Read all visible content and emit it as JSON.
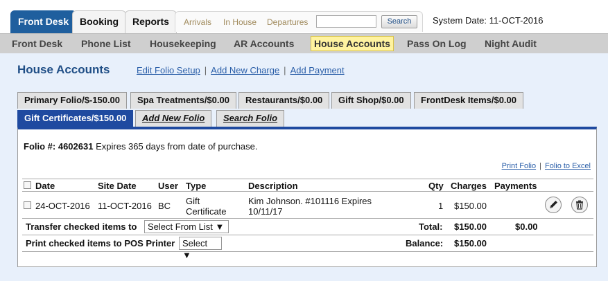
{
  "top_nav": {
    "tabs": [
      {
        "label": "Front Desk",
        "active": true
      },
      {
        "label": "Booking",
        "active": false
      },
      {
        "label": "Reports",
        "active": false
      }
    ],
    "quick_links": [
      "Arrivals",
      "In House",
      "Departures"
    ],
    "search": {
      "value": "",
      "button_label": "Search"
    },
    "system_date": "System Date: 11-OCT-2016"
  },
  "sub_nav": {
    "items": [
      {
        "label": "Front Desk",
        "active": false
      },
      {
        "label": "Phone List",
        "active": false
      },
      {
        "label": "Housekeeping",
        "active": false
      },
      {
        "label": "AR Accounts",
        "active": false
      },
      {
        "label": "House Accounts",
        "active": true
      },
      {
        "label": "Pass On Log",
        "active": false
      },
      {
        "label": "Night Audit",
        "active": false
      }
    ]
  },
  "page": {
    "title": "House Accounts",
    "actions": [
      "Edit Folio Setup",
      "Add New Charge",
      "Add Payment"
    ]
  },
  "folio_tabs": {
    "row1": [
      "Primary Folio/$-150.00",
      "Spa Treatments/$0.00",
      "Restaurants/$0.00",
      "Gift Shop/$0.00",
      "FrontDesk Items/$0.00"
    ],
    "row2": [
      {
        "label": "Gift Certificates/$150.00",
        "active": true
      },
      {
        "label": "Add New Folio",
        "active": false
      },
      {
        "label": "Search Folio",
        "active": false
      }
    ]
  },
  "folio": {
    "number_label": "Folio #:",
    "number": "4602631",
    "note": "Expires 365 days from date of purchase.",
    "print_links": [
      "Print Folio",
      "Folio to Excel"
    ]
  },
  "table": {
    "headers": [
      "Date",
      "Site Date",
      "User",
      "Type",
      "Description",
      "Qty",
      "Charges",
      "Payments"
    ],
    "rows": [
      {
        "date": "24-OCT-2016",
        "site_date": "11-OCT-2016",
        "user": "BC",
        "type_line1": "Gift",
        "type_line2": "Certificate",
        "desc_line1": "Kim Johnson. #101116 Expires",
        "desc_line2": "10/11/17",
        "qty": "1",
        "charges": "$150.00",
        "payments": ""
      }
    ],
    "transfer_label": "Transfer checked items to",
    "transfer_select": "Select From List ▼",
    "total_label": "Total:",
    "total_charges": "$150.00",
    "total_payments": "$0.00",
    "print_label": "Print checked items to POS Printer",
    "print_select": "Select ▼",
    "balance_label": "Balance:",
    "balance_value": "$150.00"
  },
  "colors": {
    "brand": "#1f5f9e",
    "tab_active": "#1f4aa0",
    "highlight": "#fff3a0",
    "content_bg": "#e8f0fb"
  }
}
